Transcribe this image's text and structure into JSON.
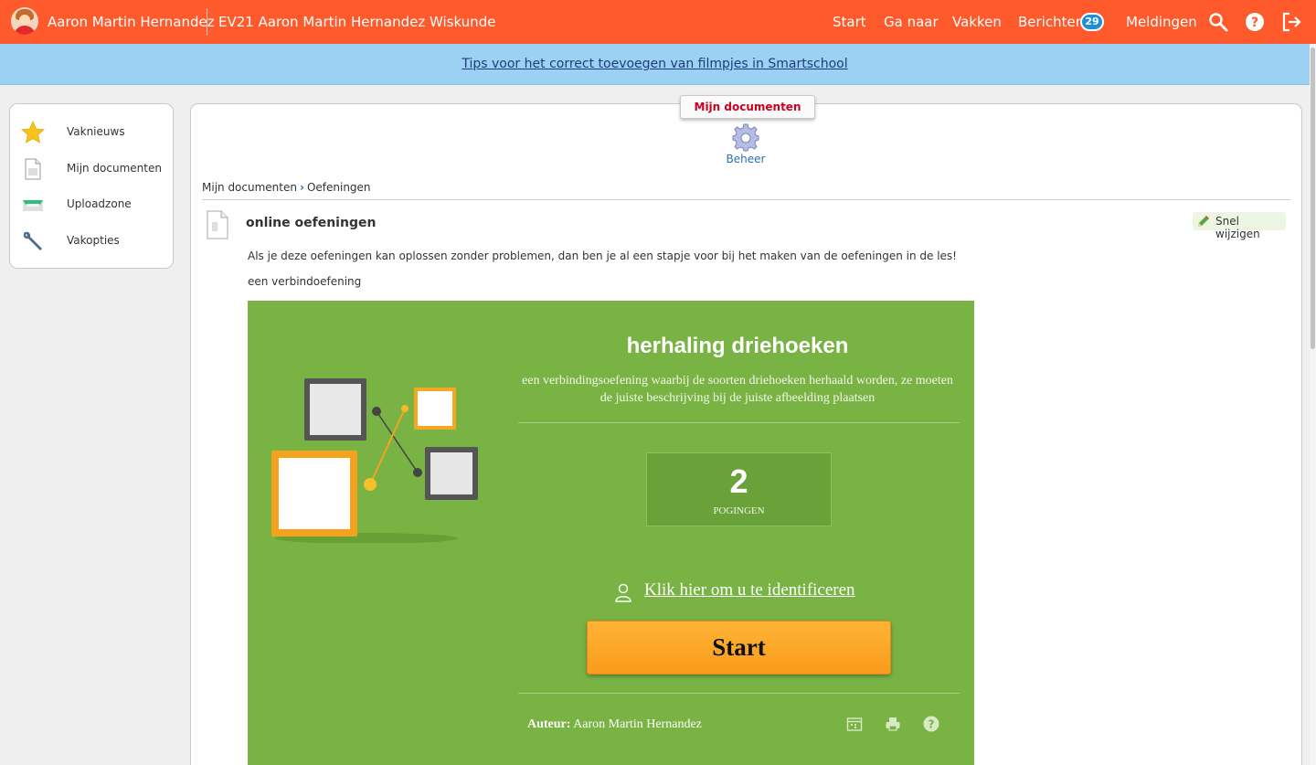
{
  "topbar": {
    "user_name": "Aaron Martin Hernandez",
    "course_title": "EV21 Aaron Martin Hernandez Wiskunde",
    "nav": [
      "Start",
      "Ga naar",
      "Vakken",
      "Berichten",
      "Meldingen"
    ],
    "messages_count": "29",
    "icons": [
      "search-icon",
      "help-icon",
      "logout-icon"
    ]
  },
  "tipbar": {
    "link": "Tips voor het correct toevoegen van filmpjes in Smartschool"
  },
  "sidebar": {
    "items": [
      {
        "label": "Vaknieuws",
        "icon": "star-icon"
      },
      {
        "label": "Mijn documenten",
        "icon": "document-icon"
      },
      {
        "label": "Uploadzone",
        "icon": "inbox-icon"
      },
      {
        "label": "Vakopties",
        "icon": "wrench-icon"
      }
    ]
  },
  "main": {
    "tab_title": "Mijn documenten",
    "beheer": "Beheer",
    "breadcrumb": [
      "Mijn documenten",
      "Oefeningen"
    ],
    "doc_title": "online oefeningen",
    "quick_edit": "Snel wijzigen",
    "description": "Als je deze oefeningen kan oplossen zonder problemen, dan ben je al een stapje voor bij het maken van de oefeningen in de les!",
    "subheading": "een verbindoefening"
  },
  "exercise": {
    "title": "herhaling driehoeken",
    "subtitle": "een verbindingsoefening waarbij de soorten driehoeken herhaald worden, ze moeten de juiste beschrijving bij de juiste afbeelding plaatsen",
    "attempts_value": "2",
    "attempts_label": "POGINGEN",
    "identify_link": "Klik hier om u te identificeren",
    "start_label": "Start",
    "author_label": "Auteur:",
    "author_name": "Aaron Martin Hernandez",
    "colors": {
      "background": "#78b343",
      "start": "#fa9b1c"
    }
  }
}
